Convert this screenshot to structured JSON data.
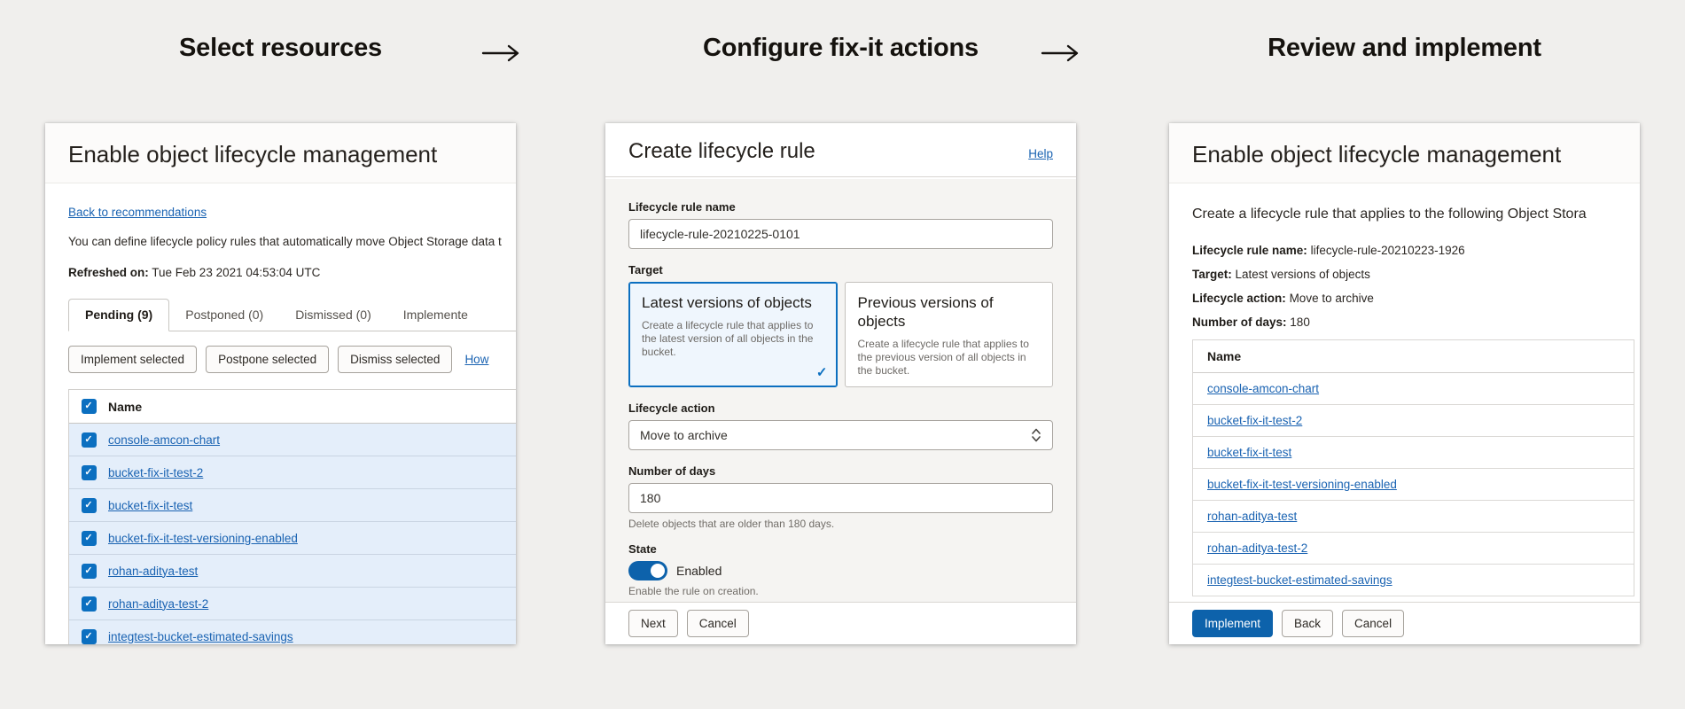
{
  "colors": {
    "page_bg": "#f0efed",
    "accent_blue": "#0d62ab",
    "control_blue": "#0b6fc0",
    "link_blue": "#1a63b2",
    "selected_row_bg": "#e4eefa",
    "selected_card_bg": "#eff6fd"
  },
  "icons": {
    "checkbox_check": "✓",
    "card_selected_check": "✓"
  },
  "steps": [
    {
      "title": "Select resources"
    },
    {
      "title": "Configure fix-it actions"
    },
    {
      "title": "Review and implement"
    }
  ],
  "panel1": {
    "title": "Enable object lifecycle management",
    "back_link": "Back to recommendations",
    "description": "You can define lifecycle policy rules that automatically move Object Storage data t",
    "refreshed_label": "Refreshed on:",
    "refreshed_value": "Tue Feb 23 2021 04:53:04 UTC",
    "tabs": [
      {
        "label": "Pending (9)"
      },
      {
        "label": "Postponed (0)"
      },
      {
        "label": "Dismissed (0)"
      },
      {
        "label": "Implemente"
      }
    ],
    "actions": [
      "Implement selected",
      "Postpone selected",
      "Dismiss selected"
    ],
    "how_link": "How",
    "table": {
      "name_header": "Name",
      "rows": [
        "console-amcon-chart",
        "bucket-fix-it-test-2",
        "bucket-fix-it-test",
        "bucket-fix-it-test-versioning-enabled",
        "rohan-aditya-test",
        "rohan-aditya-test-2",
        "integtest-bucket-estimated-savings"
      ]
    }
  },
  "panel2": {
    "title": "Create lifecycle rule",
    "help_link": "Help",
    "rule_name_label": "Lifecycle rule name",
    "rule_name_value": "lifecycle-rule-20210225-0101",
    "target_label": "Target",
    "target_options": [
      {
        "title": "Latest versions of objects",
        "description": "Create a lifecycle rule that applies to the latest version of all objects in the bucket."
      },
      {
        "title": "Previous versions of objects",
        "description": "Create a lifecycle rule that applies to the previous version of all objects in the bucket."
      }
    ],
    "action_label": "Lifecycle action",
    "action_value": "Move to archive",
    "days_label": "Number of days",
    "days_value": "180",
    "days_help": "Delete objects that are older than 180 days.",
    "state_label": "State",
    "state_value": "Enabled",
    "state_help": "Enable the rule on creation.",
    "next_button": "Next",
    "cancel_button": "Cancel"
  },
  "panel3": {
    "title": "Enable object lifecycle management",
    "description": "Create a lifecycle rule that applies to the following Object Stora",
    "summary": [
      {
        "label": "Lifecycle rule name:",
        "value": "lifecycle-rule-20210223-1926"
      },
      {
        "label": "Target:",
        "value": "Latest versions of objects"
      },
      {
        "label": "Lifecycle action:",
        "value": "Move to archive"
      },
      {
        "label": "Number of days:",
        "value": "180"
      }
    ],
    "table": {
      "name_header": "Name",
      "rows": [
        "console-amcon-chart",
        "bucket-fix-it-test-2",
        "bucket-fix-it-test",
        "bucket-fix-it-test-versioning-enabled",
        "rohan-aditya-test",
        "rohan-aditya-test-2",
        "integtest-bucket-estimated-savings"
      ]
    },
    "implement_button": "Implement",
    "back_button": "Back",
    "cancel_button": "Cancel"
  }
}
